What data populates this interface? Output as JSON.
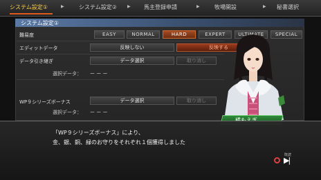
{
  "steps": [
    {
      "label": "システム設定①",
      "active": true
    },
    {
      "label": "システム設定②",
      "active": false
    },
    {
      "label": "馬主登録申請",
      "active": false
    },
    {
      "label": "牧場開設",
      "active": false
    },
    {
      "label": "秘書選択",
      "active": false
    }
  ],
  "panel": {
    "title": "システム設定①",
    "difficulty": {
      "label": "難易度",
      "options": [
        "EASY",
        "NORMAL",
        "HARD",
        "EXPERT",
        "ULTIMATE",
        "SPECIAL"
      ],
      "selected": "HARD"
    },
    "edit_data": {
      "label": "エディットデータ",
      "off": "反映しない",
      "on": "反映する"
    },
    "data_inherit": {
      "label": "データ引き継ぎ",
      "select": "データ選択",
      "cancel": "取り消し",
      "selected_label": "選択データ：",
      "selected_value": "ー ー ー"
    },
    "wp9_bonus": {
      "label": "WP９シリーズボーナス",
      "select": "データ選択",
      "cancel": "取り消し",
      "selected_label": "選択データ：",
      "selected_value": "ー ー ー"
    }
  },
  "character": {
    "name": "橘もえぎ"
  },
  "dialog": {
    "line1": "「WP９シリーズボーナス」により、",
    "line2": "金、銀、銅、緑のお守りをそれぞれ１個獲得しました"
  },
  "controls": {
    "skip_label": "既読",
    "skip_icon": "fast-forward-icon",
    "confirm_icon": "circle-button-icon"
  },
  "colors": {
    "accent": "#e05b1c",
    "active_step": "#ffd24a",
    "nameplate": "#2f8a3a",
    "hard": "#a24b22"
  }
}
